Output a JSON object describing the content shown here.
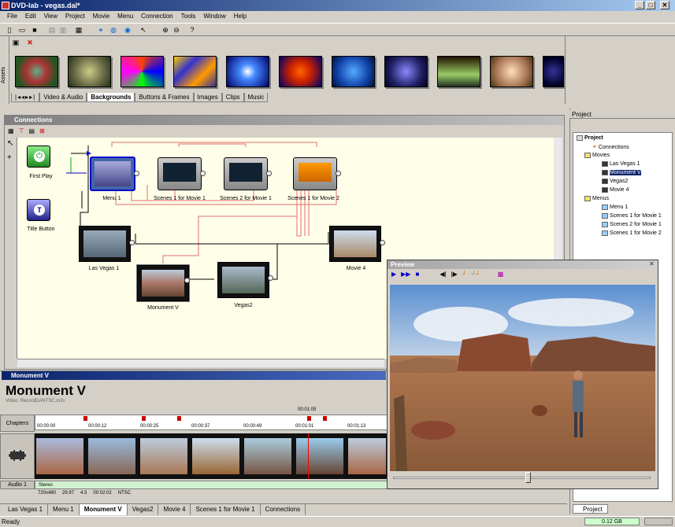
{
  "window": {
    "title": "DVD-lab - vegas.dal*",
    "min": "_",
    "max": "□",
    "close": "✕"
  },
  "menu": [
    "File",
    "Edit",
    "View",
    "Project",
    "Movie",
    "Menu",
    "Connection",
    "Tools",
    "Window",
    "Help"
  ],
  "assets": {
    "side_label": "Assets",
    "tabs": [
      "Video & Audio",
      "Backgrounds",
      "Buttons & Frames",
      "Images",
      "Clips",
      "Music"
    ],
    "selected_tab": "Backgrounds"
  },
  "connections": {
    "title": "Connections",
    "nodes": {
      "first_play": "First Play",
      "title_button": "Title Button",
      "menu1": "Menu 1",
      "scenes1": "Scenes 1 for Movie 1",
      "scenes2": "Scenes 2 for Movie 1",
      "scenes4": "Scenes 1 for Movie 2",
      "lasvegas1": "Las Vegas 1",
      "monument": "Monument V",
      "vegas2": "Vegas2",
      "movie4": "Movie 4"
    }
  },
  "movie_panel": {
    "title": "Monument V",
    "heading": "Monument V",
    "video_file": "Video: RecordDANTSC.m2v",
    "chapters_label": "Chapters",
    "audio_label": "Audio 1",
    "audio_track": "Stereo",
    "cursor_time": "00:01:05",
    "ticks": [
      "00:00:00",
      "00:00:12",
      "00:00:25",
      "00:00:37",
      "00:00:49",
      "00:01:01",
      "00:01:13"
    ],
    "info": [
      "720x480",
      "29.97",
      "4:3",
      "00:02:02",
      "NTSC"
    ]
  },
  "bottom_tabs": [
    "Las Vegas 1",
    "Menu 1",
    "Monument V",
    "Vegas2",
    "Movie 4",
    "Scenes 1 for Movie 1",
    "Connections"
  ],
  "selected_bottom_tab": "Monument V",
  "project": {
    "title": "Project",
    "tab": "Project",
    "tree": {
      "root": "Project",
      "connections": "Connections",
      "movies": "Movies",
      "movie_items": [
        "Las Vegas 1",
        "Monument V",
        "Vegas2",
        "Movie 4"
      ],
      "menus": "Menus",
      "menu_items": [
        "Menu 1",
        "Scenes 1 for Movie 1",
        "Scenes 2 for Movie 1",
        "Scenes 1 for Movie 2"
      ]
    }
  },
  "preview": {
    "title": "Preview",
    "close": "✕"
  },
  "status": {
    "text": "Ready",
    "size": "0.12 GB"
  },
  "colors": {
    "title_active": "#0a246a",
    "canvas": "#fffee8",
    "link": "#e06060",
    "selected": "#0a246a"
  }
}
